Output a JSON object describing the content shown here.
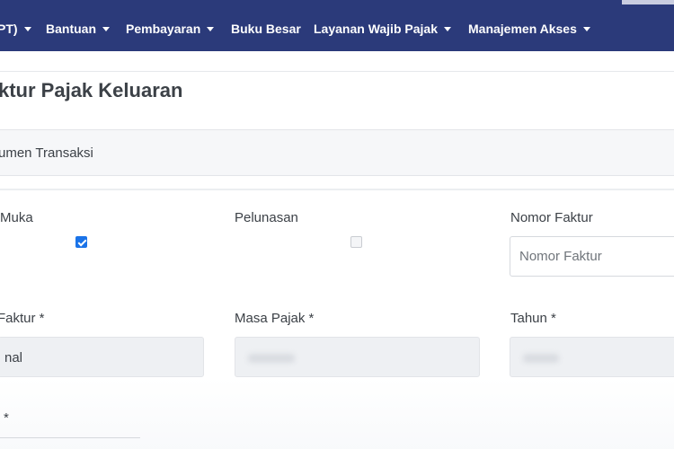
{
  "navbar": {
    "items": [
      {
        "label": "PT)",
        "has_caret": true
      },
      {
        "label": "Bantuan",
        "has_caret": true
      },
      {
        "label": "Pembayaran",
        "has_caret": true
      },
      {
        "label": "Buku Besar",
        "has_caret": false
      },
      {
        "label": "Layanan Wajib Pajak",
        "has_caret": true
      },
      {
        "label": "Manajemen Akses",
        "has_caret": true
      }
    ],
    "background": "#2b3a7a"
  },
  "page": {
    "title": "ktur Pajak Keluaran"
  },
  "section": {
    "title": "umen Transaksi"
  },
  "form": {
    "uang_muka": {
      "label": "Muka",
      "checked": true
    },
    "pelunasan": {
      "label": "Pelunasan",
      "checked": false
    },
    "nomor_faktur": {
      "label": "Nomor Faktur",
      "placeholder": "Nomor Faktur"
    },
    "jenis_faktur": {
      "label": "Faktur *",
      "value": "nal"
    },
    "masa_pajak": {
      "label": "Masa Pajak *"
    },
    "tahun": {
      "label": "Tahun *"
    },
    "next_field": {
      "label": "*"
    }
  },
  "colors": {
    "accent": "#1a73e8",
    "navbar": "#2b3a7a"
  }
}
